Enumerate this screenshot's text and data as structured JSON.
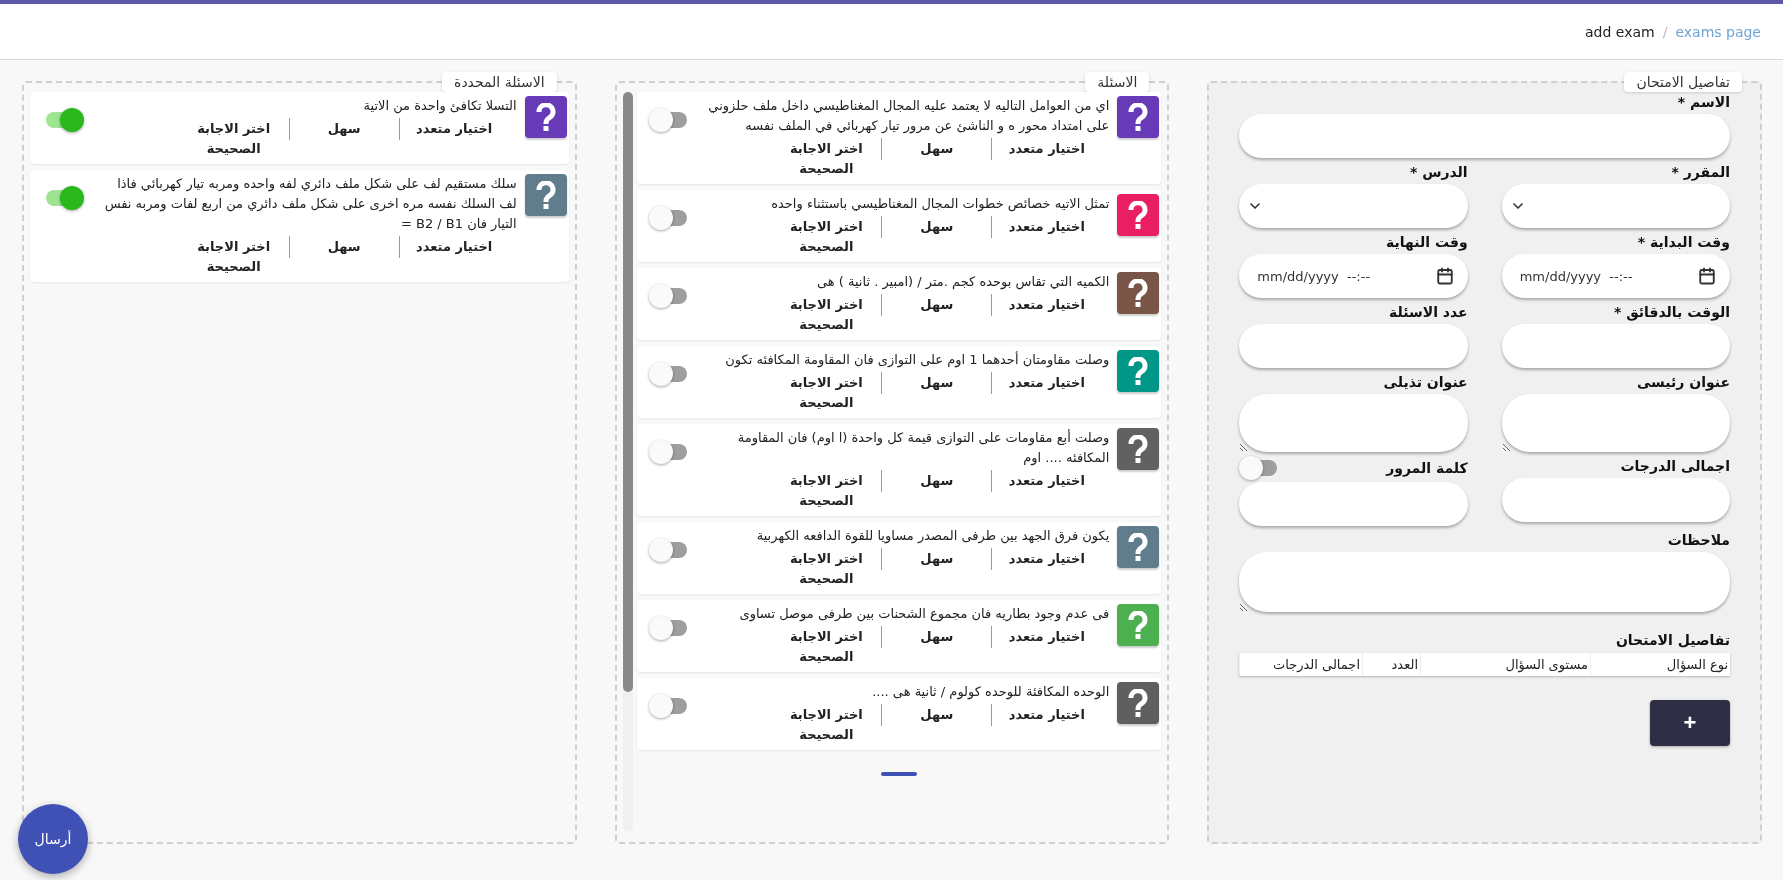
{
  "breadcrumb": {
    "items": [
      {
        "label": "exams page",
        "link": true
      },
      {
        "label": "add exam",
        "link": false
      }
    ],
    "separator": "/"
  },
  "exam_details": {
    "title": "تفاصيل الامتحان",
    "fields": [
      {
        "kind": "text",
        "label": "الاسم *",
        "wide": true
      },
      {
        "kind": "select",
        "label": "المقرر *",
        "wide": false
      },
      {
        "kind": "select",
        "label": "الدرس *",
        "wide": false
      },
      {
        "kind": "datetime",
        "label": "وقت البداية *",
        "wide": false,
        "placeholder": "mm/dd/yyyy  --:--"
      },
      {
        "kind": "datetime",
        "label": "وقت النهاية",
        "wide": false,
        "placeholder": "mm/dd/yyyy  --:--"
      },
      {
        "kind": "text",
        "label": "الوقت بالدقائق *",
        "wide": false
      },
      {
        "kind": "text",
        "label": "عدد الاسئلة",
        "wide": false
      },
      {
        "kind": "textarea",
        "label": "عنوان رئيسى",
        "wide": false
      },
      {
        "kind": "textarea",
        "label": "عنوان تذيلى",
        "wide": false
      },
      {
        "kind": "text",
        "label": "اجمالى الدرجات",
        "wide": false
      },
      {
        "kind": "toggle-text",
        "label": "كلمة المرور",
        "wide": false,
        "on": false
      },
      {
        "kind": "textarea",
        "label": "ملاحظات",
        "wide": true
      }
    ],
    "table_title": "تفاصيل الامتحان",
    "table": {
      "columns": [
        "نوع السؤال",
        "مستوى السؤال",
        "العدد",
        "اجمالى الدرجات"
      ]
    },
    "add_button": "+"
  },
  "questions": {
    "title": "الاسئلة",
    "items": [
      {
        "text": "اي من العوامل التاليه لا يعتمد عليه المجال المغناطيسي داخل ملف حلزوني على امتداد محور ه و الناشئ عن مرور تيار كهربائي في الملف نفسه",
        "type": "اختيار متعدد",
        "level": "سهل",
        "instruction": "اختر الاجابة الصحيحة",
        "color": "#673ab7",
        "on": false
      },
      {
        "text": "تمثل الاتيه خصائص خطوات المجال المغناطيسي باستثناء واحده",
        "type": "اختيار متعدد",
        "level": "سهل",
        "instruction": "اختر الاجابة الصحيحة",
        "color": "#e91e63",
        "on": false
      },
      {
        "text": "الكميه التي تقاس بوحده كجم .متر / (امبير . ثانية ) هى",
        "type": "اختيار متعدد",
        "level": "سهل",
        "instruction": "اختر الاجابة الصحيحة",
        "color": "#795548",
        "on": false
      },
      {
        "text": "وصلت مقاومتان أحدهما 1 اوم على التوازى فان المقاومة المكافئه تكون",
        "type": "اختيار متعدد",
        "level": "سهل",
        "instruction": "اختر الاجابة الصحيحة",
        "color": "#009688",
        "on": false
      },
      {
        "text": "وصلت أبع مقاومات على التوازى قيمة كل واحدة (ا اوم) فان المقاومة المكافئه .... اوم",
        "type": "اختيار متعدد",
        "level": "سهل",
        "instruction": "اختر الاجابة الصحيحة",
        "color": "#616161",
        "on": false
      },
      {
        "text": "يكون فرق الجهد بين طرفى المصدر مساويا للقوة الدافعه الكهربية",
        "type": "اختيار متعدد",
        "level": "سهل",
        "instruction": "اختر الاجابة الصحيحة",
        "color": "#607d8b",
        "on": false
      },
      {
        "text": "فى عدم وجود بطاريه فان مجموع الشحنات بين طرفى موصل تساوى",
        "type": "اختيار متعدد",
        "level": "سهل",
        "instruction": "اختر الاجابة الصحيحة",
        "color": "#4caf50",
        "on": false
      },
      {
        "text": "الوحده المكافئة للوحده كولوم / ثانية هى ....",
        "type": "اختيار متعدد",
        "level": "سهل",
        "instruction": "اختر الاجابة الصحيحة",
        "color": "#5f5f5f",
        "on": false
      }
    ]
  },
  "selected_questions": {
    "title": "الاسئلة المحددة",
    "items": [
      {
        "text": "التسلا تكافئ واحدة من الاتية",
        "type": "اختيار متعدد",
        "level": "سهل",
        "instruction": "اختر الاجابة الصحيحة",
        "color": "#673ab7",
        "on": true
      },
      {
        "text": "سلك مستقيم لف على شكل ملف دائري لفه واحده ومربه تيار كهربائي فاذا لف السلك نفسه مره اخرى على شكل ملف دائري من اربع لفات ومربه نفس التيار فان B2 / B1 =",
        "type": "اختيار متعدد",
        "level": "سهل",
        "instruction": "اختر الاجابة الصحيحة",
        "color": "#607d8b",
        "on": true
      }
    ]
  },
  "send_button": "أرسال"
}
